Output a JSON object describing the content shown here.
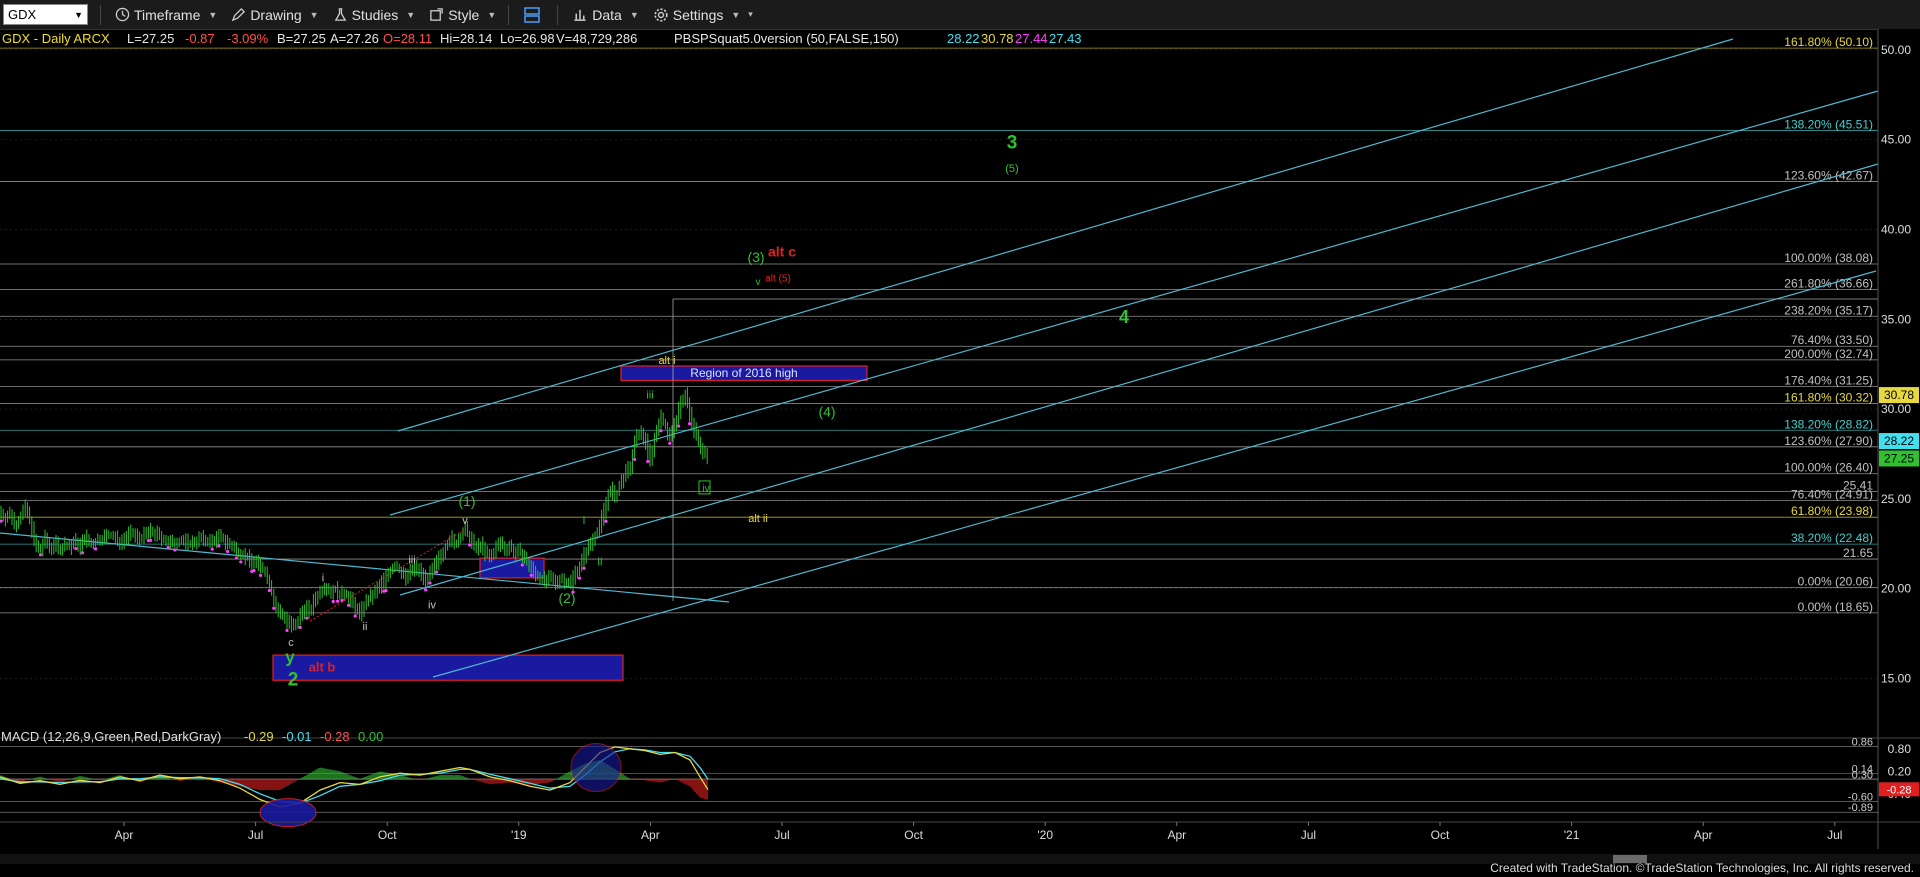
{
  "toolbar": {
    "symbol": "GDX",
    "timeframe": "Timeframe",
    "drawing": "Drawing",
    "studies": "Studies",
    "style": "Style",
    "data": "Data",
    "settings": "Settings"
  },
  "header": {
    "symbol_line": "GDX - Daily  ARCX",
    "last": "L=27.25",
    "chg": "-0.87",
    "pct": "-3.09%",
    "bid": "B=27.25",
    "ask": "A=27.26",
    "open": "O=28.11",
    "hi": "Hi=28.14",
    "lo": "Lo=26.98",
    "vol": "V=48,729,286",
    "study": "PBSPSquat5.0version (50,FALSE,150)",
    "study_vals": [
      "28.22",
      "30.78",
      "27.44",
      "27.43"
    ],
    "study_colors": [
      "#40e0f0",
      "#e8d840",
      "#ff40ff",
      "#40e0f0"
    ]
  },
  "colors": {
    "bg": "#000000",
    "grid": "#2a2a2a",
    "channel": "#4fb8d0",
    "fib": "#a8a8a8",
    "blue_box": "#1a1aa0",
    "label_green": "#30c030",
    "label_yellow": "#e8d840",
    "label_red": "#e02020"
  },
  "chart_data": {
    "type": "candlestick",
    "title": "GDX - Daily",
    "y_range": [
      13.8,
      51
    ],
    "y_ticks": [
      15,
      20,
      25,
      30,
      35,
      40,
      45,
      50
    ],
    "x_tick_labels": [
      "Apr",
      "Jul",
      "Oct",
      "'19",
      "Apr",
      "Jul",
      "Oct",
      "'20",
      "Apr",
      "Jul",
      "Oct",
      "'21",
      "Apr",
      "Jul"
    ],
    "last_price_tags": [
      {
        "value": 30.78,
        "label": "30.78",
        "bg": "#e8d840",
        "fg": "#000000"
      },
      {
        "value": 28.22,
        "label": "28.22",
        "bg": "#40e0f0",
        "fg": "#000000"
      },
      {
        "value": 27.25,
        "label": "27.25",
        "bg": "#30c030",
        "fg": "#000000"
      }
    ],
    "fib_levels": [
      {
        "label": "161.80% (50.10)",
        "value": 50.1,
        "color": "#e8d840"
      },
      {
        "label": "138.20% (45.51)",
        "value": 45.51,
        "color": "#40d0d0"
      },
      {
        "label": "123.60% (42.67)",
        "value": 42.67,
        "color": "#c0c0c0"
      },
      {
        "label": "100.00% (38.08)",
        "value": 38.08,
        "color": "#c0c0c0"
      },
      {
        "label": "261.80% (36.66)",
        "value": 36.66,
        "color": "#c0c0c0"
      },
      {
        "label": "238.20% (35.17)",
        "value": 35.17,
        "color": "#c0c0c0"
      },
      {
        "label": "76.40% (33.50)",
        "value": 33.5,
        "color": "#c0c0c0"
      },
      {
        "label": "200.00% (32.74)",
        "value": 32.74,
        "color": "#c0c0c0"
      },
      {
        "label": "176.40% (31.25)",
        "value": 31.25,
        "color": "#c0c0c0"
      },
      {
        "label": "161.80% (30.32)",
        "value": 30.32,
        "color": "#e8d840"
      },
      {
        "label": "138.20% (28.82)",
        "value": 28.82,
        "color": "#40d0d0"
      },
      {
        "label": "123.60% (27.90)",
        "value": 27.9,
        "color": "#c0c0c0"
      },
      {
        "label": "100.00% (26.40)",
        "value": 26.4,
        "color": "#c0c0c0"
      },
      {
        "label": "25.41",
        "value": 25.41,
        "color": "#c0c0c0"
      },
      {
        "label": "76.40% (24.91)",
        "value": 24.91,
        "color": "#c0c0c0"
      },
      {
        "label": "61.80% (23.98)",
        "value": 23.98,
        "color": "#e8d840"
      },
      {
        "label": "38.20% (22.48)",
        "value": 22.48,
        "color": "#40d0d0"
      },
      {
        "label": "21.65",
        "value": 21.65,
        "color": "#c0c0c0"
      },
      {
        "label": "0.00% (20.06)",
        "value": 20.06,
        "color": "#c0c0c0"
      },
      {
        "label": "0.00% (18.65)",
        "value": 18.65,
        "color": "#c0c0c0"
      }
    ],
    "price_series": [
      [
        0,
        24.3
      ],
      [
        5,
        23.9
      ],
      [
        10,
        24.2
      ],
      [
        15,
        23.5
      ],
      [
        20,
        24.0
      ],
      [
        25,
        24.5
      ],
      [
        30,
        23.8
      ],
      [
        35,
        22.4
      ],
      [
        40,
        22.1
      ],
      [
        45,
        22.8
      ],
      [
        50,
        22.2
      ],
      [
        55,
        22.6
      ],
      [
        60,
        22.1
      ],
      [
        65,
        22.5
      ],
      [
        70,
        22.3
      ],
      [
        75,
        22.7
      ],
      [
        80,
        22.3
      ],
      [
        85,
        22.9
      ],
      [
        90,
        22.4
      ],
      [
        95,
        22.6
      ],
      [
        100,
        22.8
      ],
      [
        110,
        23.0
      ],
      [
        120,
        22.6
      ],
      [
        130,
        23.1
      ],
      [
        140,
        22.8
      ],
      [
        150,
        23.2
      ],
      [
        160,
        22.9
      ],
      [
        170,
        22.5
      ],
      [
        180,
        22.7
      ],
      [
        190,
        22.5
      ],
      [
        200,
        22.8
      ],
      [
        210,
        22.6
      ],
      [
        220,
        22.9
      ],
      [
        230,
        22.4
      ],
      [
        240,
        22.0
      ],
      [
        250,
        21.6
      ],
      [
        260,
        21.3
      ],
      [
        265,
        20.9
      ],
      [
        270,
        20.2
      ],
      [
        275,
        19.0
      ],
      [
        280,
        18.6
      ],
      [
        285,
        18.4
      ],
      [
        290,
        18.0
      ],
      [
        295,
        17.8
      ],
      [
        300,
        18.5
      ],
      [
        305,
        19.0
      ],
      [
        310,
        18.7
      ],
      [
        315,
        19.5
      ],
      [
        320,
        19.8
      ],
      [
        325,
        20.2
      ],
      [
        330,
        19.8
      ],
      [
        335,
        20.0
      ],
      [
        340,
        19.6
      ],
      [
        345,
        19.8
      ],
      [
        350,
        19.4
      ],
      [
        355,
        19.0
      ],
      [
        360,
        18.6
      ],
      [
        365,
        19.2
      ],
      [
        370,
        19.5
      ],
      [
        375,
        19.8
      ],
      [
        380,
        20.2
      ],
      [
        385,
        20.6
      ],
      [
        390,
        21.0
      ],
      [
        395,
        21.3
      ],
      [
        400,
        21.0
      ],
      [
        405,
        20.6
      ],
      [
        410,
        20.9
      ],
      [
        415,
        21.2
      ],
      [
        420,
        21.0
      ],
      [
        425,
        20.5
      ],
      [
        430,
        20.8
      ],
      [
        435,
        21.3
      ],
      [
        440,
        21.8
      ],
      [
        445,
        22.3
      ],
      [
        450,
        22.8
      ],
      [
        455,
        22.4
      ],
      [
        460,
        22.9
      ],
      [
        465,
        23.3
      ],
      [
        470,
        22.8
      ],
      [
        475,
        22.2
      ],
      [
        480,
        22.5
      ],
      [
        485,
        22.0
      ],
      [
        490,
        21.7
      ],
      [
        495,
        22.2
      ],
      [
        500,
        22.6
      ],
      [
        505,
        22.2
      ],
      [
        510,
        22.4
      ],
      [
        515,
        21.9
      ],
      [
        520,
        22.1
      ],
      [
        525,
        21.6
      ],
      [
        530,
        21.2
      ],
      [
        535,
        20.8
      ],
      [
        540,
        20.6
      ],
      [
        545,
        20.4
      ],
      [
        550,
        20.6
      ],
      [
        555,
        20.3
      ],
      [
        560,
        20.6
      ],
      [
        565,
        20.4
      ],
      [
        570,
        20.3
      ],
      [
        575,
        20.9
      ],
      [
        580,
        21.3
      ],
      [
        585,
        22.0
      ],
      [
        590,
        22.5
      ],
      [
        595,
        23.0
      ],
      [
        600,
        23.6
      ],
      [
        605,
        24.6
      ],
      [
        610,
        25.6
      ],
      [
        615,
        25.0
      ],
      [
        620,
        25.8
      ],
      [
        625,
        26.4
      ],
      [
        630,
        26.8
      ],
      [
        635,
        28.2
      ],
      [
        640,
        28.8
      ],
      [
        645,
        28.3
      ],
      [
        650,
        27.2
      ],
      [
        655,
        28.5
      ],
      [
        660,
        29.6
      ],
      [
        665,
        29.1
      ],
      [
        670,
        28.4
      ],
      [
        675,
        29.2
      ],
      [
        680,
        30.2
      ],
      [
        685,
        30.9
      ],
      [
        690,
        29.6
      ],
      [
        695,
        28.6
      ],
      [
        700,
        28.0
      ],
      [
        705,
        27.4
      ],
      [
        708,
        27.25
      ]
    ],
    "waves": [
      {
        "text": "y",
        "x": 290,
        "v": 15.9,
        "color": "#30c030",
        "size": 17,
        "bold": true
      },
      {
        "text": "2",
        "x": 293,
        "v": 14.6,
        "color": "#30c030",
        "size": 19,
        "bold": true
      },
      {
        "text": "c",
        "x": 291,
        "v": 16.8,
        "color": "#c0c0c0",
        "size": 11
      },
      {
        "text": "alt b",
        "x": 322,
        "v": 15.4,
        "color": "#e02020",
        "size": 13,
        "bold": true
      },
      {
        "text": "i",
        "x": 323,
        "v": 20.4,
        "color": "#c0c0c0",
        "size": 11
      },
      {
        "text": "ii",
        "x": 365,
        "v": 17.7,
        "color": "#c0c0c0",
        "size": 11
      },
      {
        "text": "iii",
        "x": 412,
        "v": 21.4,
        "color": "#c0c0c0",
        "size": 11
      },
      {
        "text": "iv",
        "x": 432,
        "v": 18.9,
        "color": "#c0c0c0",
        "size": 11
      },
      {
        "text": "v",
        "x": 465,
        "v": 23.6,
        "color": "#c0c0c0",
        "size": 11
      },
      {
        "text": "(1)",
        "x": 467,
        "v": 24.6,
        "color": "#30c030",
        "size": 14
      },
      {
        "text": "(2)",
        "x": 567,
        "v": 19.2,
        "color": "#30c030",
        "size": 14
      },
      {
        "text": "i",
        "x": 584,
        "v": 23.6,
        "color": "#30c030",
        "size": 11
      },
      {
        "text": "ii",
        "x": 600,
        "v": 21.3,
        "color": "#30c030",
        "size": 11
      },
      {
        "text": "iii",
        "x": 650,
        "v": 30.6,
        "color": "#30c030",
        "size": 11
      },
      {
        "text": "alt i",
        "x": 667,
        "v": 32.5,
        "color": "#e8d840",
        "size": 11
      },
      {
        "text": "iv",
        "x": 706,
        "v": 25.4,
        "color": "#30c030",
        "size": 10
      },
      {
        "text": "alt ii",
        "x": 758,
        "v": 23.7,
        "color": "#e8d840",
        "size": 11
      },
      {
        "text": "(3)",
        "x": 756,
        "v": 38.2,
        "color": "#30c030",
        "size": 14
      },
      {
        "text": "v",
        "x": 758,
        "v": 36.9,
        "color": "#30c030",
        "size": 10
      },
      {
        "text": "alt c",
        "x": 782,
        "v": 38.5,
        "color": "#e02020",
        "size": 14,
        "bold": true
      },
      {
        "text": "alt (5)",
        "x": 778,
        "v": 37.1,
        "color": "#e02020",
        "size": 10
      },
      {
        "text": "(4)",
        "x": 827,
        "v": 29.6,
        "color": "#30c030",
        "size": 14
      },
      {
        "text": "3",
        "x": 1012,
        "v": 44.5,
        "color": "#30c030",
        "size": 19,
        "bold": true
      },
      {
        "text": "(5)",
        "x": 1012,
        "v": 43.2,
        "color": "#30c030",
        "size": 11
      },
      {
        "text": "4",
        "x": 1124,
        "v": 34.8,
        "color": "#30c030",
        "size": 18,
        "bold": true
      }
    ],
    "boxes": [
      {
        "x1": 273,
        "x2": 623,
        "v1": 14.9,
        "v2": 16.3,
        "label": ""
      },
      {
        "x1": 480,
        "x2": 544,
        "v1": 20.6,
        "v2": 21.7,
        "label": ""
      },
      {
        "x1": 621,
        "x2": 867,
        "v1": 31.6,
        "v2": 32.4,
        "label": "Region of 2016 high"
      }
    ],
    "macd": {
      "title": "MACD (12,26,9,Green,Red,DarkGray)",
      "values": [
        "-0.29",
        "-0.01",
        "-0.28",
        "0.00"
      ],
      "value_colors": [
        "#e8d840",
        "#40e0f0",
        "#ff5050",
        "#30c030"
      ],
      "range": [
        -1.15,
        0.98
      ],
      "ticks": [
        0.8,
        0.2,
        -0.4
      ],
      "right_labels": [
        {
          "text": "0.86",
          "v": 0.86
        },
        {
          "text": "0.14",
          "v": 0.14
        },
        {
          "text": "0.30",
          "v": -0.02
        },
        {
          "text": "-0.60",
          "v": -0.6
        },
        {
          "text": "-0.89",
          "v": -0.89
        }
      ],
      "tags": [
        {
          "value": -0.28,
          "label": "-0.28",
          "bg": "#e02020",
          "fg": "#ffffff"
        }
      ],
      "macd_line": [
        [
          0,
          0.05
        ],
        [
          20,
          -0.12
        ],
        [
          40,
          -0.05
        ],
        [
          60,
          -0.15
        ],
        [
          80,
          -0.04
        ],
        [
          100,
          -0.1
        ],
        [
          120,
          0.05
        ],
        [
          140,
          -0.05
        ],
        [
          160,
          0.1
        ],
        [
          180,
          0.0
        ],
        [
          200,
          0.05
        ],
        [
          220,
          -0.05
        ],
        [
          240,
          -0.25
        ],
        [
          260,
          -0.55
        ],
        [
          280,
          -0.75
        ],
        [
          300,
          -0.65
        ],
        [
          320,
          -0.3
        ],
        [
          340,
          -0.1
        ],
        [
          360,
          -0.15
        ],
        [
          380,
          0.05
        ],
        [
          400,
          0.15
        ],
        [
          420,
          0.1
        ],
        [
          440,
          0.2
        ],
        [
          460,
          0.3
        ],
        [
          470,
          0.25
        ],
        [
          490,
          0.05
        ],
        [
          510,
          -0.05
        ],
        [
          530,
          -0.2
        ],
        [
          550,
          -0.3
        ],
        [
          570,
          -0.1
        ],
        [
          585,
          0.3
        ],
        [
          600,
          0.7
        ],
        [
          615,
          0.85
        ],
        [
          630,
          0.8
        ],
        [
          645,
          0.75
        ],
        [
          660,
          0.65
        ],
        [
          675,
          0.7
        ],
        [
          690,
          0.5
        ],
        [
          700,
          0.05
        ],
        [
          708,
          -0.29
        ]
      ],
      "signal_line": [
        [
          0,
          0.0
        ],
        [
          20,
          -0.08
        ],
        [
          40,
          -0.08
        ],
        [
          60,
          -0.1
        ],
        [
          80,
          -0.08
        ],
        [
          100,
          -0.08
        ],
        [
          120,
          0.0
        ],
        [
          140,
          0.0
        ],
        [
          160,
          0.05
        ],
        [
          180,
          0.03
        ],
        [
          200,
          0.03
        ],
        [
          220,
          0.0
        ],
        [
          240,
          -0.15
        ],
        [
          260,
          -0.4
        ],
        [
          280,
          -0.6
        ],
        [
          300,
          -0.65
        ],
        [
          320,
          -0.45
        ],
        [
          340,
          -0.2
        ],
        [
          360,
          -0.15
        ],
        [
          380,
          -0.05
        ],
        [
          400,
          0.1
        ],
        [
          420,
          0.12
        ],
        [
          440,
          0.15
        ],
        [
          460,
          0.25
        ],
        [
          470,
          0.25
        ],
        [
          490,
          0.12
        ],
        [
          510,
          0.0
        ],
        [
          530,
          -0.12
        ],
        [
          550,
          -0.25
        ],
        [
          570,
          -0.2
        ],
        [
          585,
          0.1
        ],
        [
          600,
          0.45
        ],
        [
          615,
          0.72
        ],
        [
          630,
          0.8
        ],
        [
          645,
          0.77
        ],
        [
          660,
          0.7
        ],
        [
          675,
          0.7
        ],
        [
          690,
          0.6
        ],
        [
          700,
          0.3
        ],
        [
          708,
          -0.01
        ]
      ]
    }
  },
  "footer": "Created with TradeStation. ©TradeStation Technologies, Inc. All rights reserved."
}
